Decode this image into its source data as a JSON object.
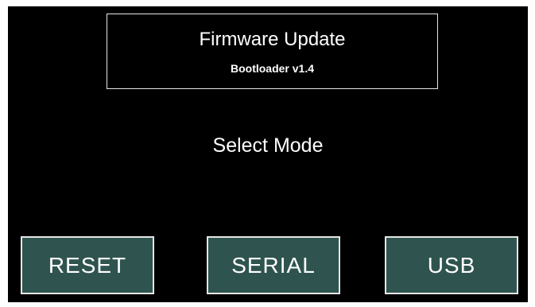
{
  "header": {
    "title": "Firmware Update",
    "subtitle": "Bootloader v1.4"
  },
  "main": {
    "prompt": "Select Mode"
  },
  "buttons": {
    "reset_label": "RESET",
    "serial_label": "SERIAL",
    "usb_label": "USB"
  },
  "colors": {
    "background": "#000000",
    "button_fill": "#2f5450",
    "border": "#e6e6e6",
    "text": "#ffffff"
  }
}
